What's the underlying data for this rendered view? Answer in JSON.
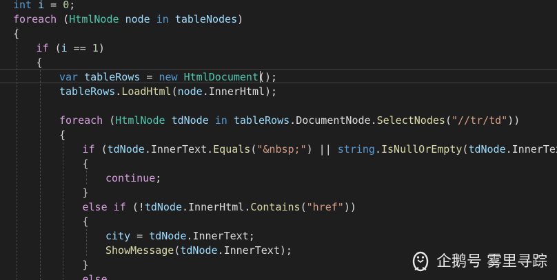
{
  "colors": {
    "background": "#1e1e1e",
    "keyword": "#569cd6",
    "control": "#d8a0df",
    "type": "#4ec9b0",
    "variable": "#9cdcfe",
    "method": "#dcdcaa",
    "string": "#d69d85",
    "number": "#b5cea8",
    "default": "#dcdcdc"
  },
  "code": [
    [
      [
        "kw",
        "int"
      ],
      [
        "punc",
        " "
      ],
      [
        "var",
        "i"
      ],
      [
        "punc",
        " = "
      ],
      [
        "num",
        "0"
      ],
      [
        "punc",
        ";"
      ]
    ],
    [
      [
        "ctl",
        "foreach"
      ],
      [
        "punc",
        " ("
      ],
      [
        "type",
        "HtmlNode"
      ],
      [
        "punc",
        " "
      ],
      [
        "var",
        "node"
      ],
      [
        "punc",
        " "
      ],
      [
        "kw",
        "in"
      ],
      [
        "punc",
        " "
      ],
      [
        "var",
        "tableNodes"
      ],
      [
        "punc",
        ")"
      ]
    ],
    [
      [
        "punc",
        "{"
      ]
    ],
    [
      [
        "ctl",
        "if"
      ],
      [
        "punc",
        " ("
      ],
      [
        "var",
        "i"
      ],
      [
        "punc",
        " == "
      ],
      [
        "num",
        "1"
      ],
      [
        "punc",
        ")"
      ]
    ],
    [
      [
        "punc",
        "{"
      ]
    ],
    [
      [
        "kw",
        "var"
      ],
      [
        "punc",
        " "
      ],
      [
        "var",
        "tableRows"
      ],
      [
        "punc",
        " = "
      ],
      [
        "kw",
        "new"
      ],
      [
        "punc",
        " "
      ],
      [
        "type",
        "HtmlDocument"
      ],
      [
        "punc",
        "();"
      ]
    ],
    [
      [
        "var",
        "tableRows"
      ],
      [
        "punc",
        "."
      ],
      [
        "meth",
        "LoadHtml"
      ],
      [
        "punc",
        "("
      ],
      [
        "var",
        "node"
      ],
      [
        "punc",
        "."
      ],
      [
        "prop",
        "InnerHtml"
      ],
      [
        "punc",
        ");"
      ]
    ],
    [],
    [
      [
        "ctl",
        "foreach"
      ],
      [
        "punc",
        " ("
      ],
      [
        "type",
        "HtmlNode"
      ],
      [
        "punc",
        " "
      ],
      [
        "var",
        "tdNode"
      ],
      [
        "punc",
        " "
      ],
      [
        "kw",
        "in"
      ],
      [
        "punc",
        " "
      ],
      [
        "var",
        "tableRows"
      ],
      [
        "punc",
        "."
      ],
      [
        "prop",
        "DocumentNode"
      ],
      [
        "punc",
        "."
      ],
      [
        "meth",
        "SelectNodes"
      ],
      [
        "punc",
        "("
      ],
      [
        "str",
        "\"//tr/td\""
      ],
      [
        "punc",
        "))"
      ]
    ],
    [
      [
        "punc",
        "{"
      ]
    ],
    [
      [
        "ctl",
        "if"
      ],
      [
        "punc",
        " ("
      ],
      [
        "var",
        "tdNode"
      ],
      [
        "punc",
        "."
      ],
      [
        "prop",
        "InnerText"
      ],
      [
        "punc",
        "."
      ],
      [
        "meth",
        "Equals"
      ],
      [
        "punc",
        "("
      ],
      [
        "str",
        "\"&nbsp;\""
      ],
      [
        "punc",
        ") || "
      ],
      [
        "kw",
        "string"
      ],
      [
        "punc",
        "."
      ],
      [
        "meth",
        "IsNullOrEmpty"
      ],
      [
        "punc",
        "("
      ],
      [
        "var",
        "tdNode"
      ],
      [
        "punc",
        "."
      ],
      [
        "prop",
        "InnerText"
      ],
      [
        "punc",
        "))"
      ]
    ],
    [
      [
        "punc",
        "{"
      ]
    ],
    [
      [
        "ctl",
        "continue"
      ],
      [
        "punc",
        ";"
      ]
    ],
    [
      [
        "punc",
        "}"
      ]
    ],
    [
      [
        "ctl",
        "else"
      ],
      [
        "punc",
        " "
      ],
      [
        "ctl",
        "if"
      ],
      [
        "punc",
        " (!"
      ],
      [
        "var",
        "tdNode"
      ],
      [
        "punc",
        "."
      ],
      [
        "prop",
        "InnerHtml"
      ],
      [
        "punc",
        "."
      ],
      [
        "meth",
        "Contains"
      ],
      [
        "punc",
        "("
      ],
      [
        "str",
        "\"href\""
      ],
      [
        "punc",
        "))"
      ]
    ],
    [
      [
        "punc",
        "{"
      ]
    ],
    [
      [
        "var",
        "city"
      ],
      [
        "punc",
        " = "
      ],
      [
        "var",
        "tdNode"
      ],
      [
        "punc",
        "."
      ],
      [
        "prop",
        "InnerText"
      ],
      [
        "punc",
        ";"
      ]
    ],
    [
      [
        "meth",
        "ShowMessage"
      ],
      [
        "punc",
        "("
      ],
      [
        "var",
        "tdNode"
      ],
      [
        "punc",
        "."
      ],
      [
        "prop",
        "InnerText"
      ],
      [
        "punc",
        ");"
      ]
    ],
    [
      [
        "punc",
        "}"
      ]
    ],
    [
      [
        "ctl",
        "else"
      ]
    ]
  ],
  "watermark": {
    "text": "企鹅号 雾里寻踪",
    "icon": "penguin-icon"
  }
}
